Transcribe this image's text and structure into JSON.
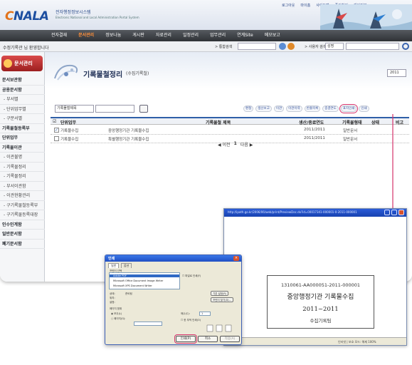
{
  "header": {
    "logo_lead": "C",
    "logo_rest": "NALA",
    "system_name": "전자행정정보시스템",
    "system_name_en": "Electronic National and Local Administration Portal System",
    "util_links": [
      "로그아웃",
      "마이홈",
      "사이트맵",
      "즐겨찾기",
      "개인정보"
    ]
  },
  "menu": [
    "전자결재",
    "문서관리",
    "정보나눔",
    "게시판",
    "자료관리",
    "일정관리",
    "업무관리",
    "연계Site",
    "메모보고"
  ],
  "menu_active_index": 1,
  "status": {
    "login": "수정기록관 님 환영합니다",
    "combined_search": "> 통합검색",
    "user_search": "> 사용자 검색",
    "user_search_option": "성명"
  },
  "sidebar": {
    "header": "문서관리",
    "items": [
      {
        "label": "문서보관함",
        "kind": "group"
      },
      {
        "label": "공용문서함",
        "kind": "group"
      },
      {
        "label": "- 부서별",
        "kind": "sub"
      },
      {
        "label": "- 단위업무별",
        "kind": "sub"
      },
      {
        "label": "- 구분서별",
        "kind": "sub"
      },
      {
        "label": "기록물철등록부",
        "kind": "group"
      },
      {
        "label": "단위업무",
        "kind": "group"
      },
      {
        "label": "기록물이관",
        "kind": "group"
      },
      {
        "label": "- 이관불명",
        "kind": "sub"
      },
      {
        "label": "- 기록물정리",
        "kind": "sub"
      },
      {
        "label": "- 기록물정리",
        "kind": "sub"
      },
      {
        "label": "- 부서이관함",
        "kind": "sub"
      },
      {
        "label": "- 이관현황관리",
        "kind": "sub"
      },
      {
        "label": "- 구기록물철등록부",
        "kind": "sub"
      },
      {
        "label": "- 구기록물등록대장",
        "kind": "sub"
      },
      {
        "label": "인수인계함",
        "kind": "group"
      },
      {
        "label": "일반문서함",
        "kind": "group"
      },
      {
        "label": "폐기문서함",
        "kind": "group"
      }
    ]
  },
  "page": {
    "title": "기록물철정리",
    "subtitle": "(수집기록철)",
    "year": "2011",
    "filter_option": "기록물철제목",
    "actions": [
      "편철",
      "생산보고",
      "이관",
      "이관이력",
      "반출목록",
      "종결연도",
      "표지인쇄",
      "인쇄"
    ],
    "highlighted_action_index": 6
  },
  "table": {
    "headers": {
      "task": "단위업무",
      "title": "기록물철 제목",
      "years": "생산/종료연도",
      "type": "기록물형태",
      "state": "상태",
      "note": "비고"
    },
    "rows": [
      {
        "task": "기록물수집",
        "title": "중앙행정기관 기록물수집",
        "years": "2011/2011",
        "type": "일반문서",
        "checked": true
      },
      {
        "task": "기록물수집",
        "title": "특별행정기관 기록물수집",
        "years": "2011/2011",
        "type": "일반문서",
        "checked": false
      }
    ]
  },
  "pagination": {
    "prev": "◀ 이전",
    "current": "1",
    "next": "다음 ▶"
  },
  "preview": {
    "url": "http://ipath.go.kr/2006/06/web/print/PreviewDoc.do?id=00017341-000001-0-2011-000001",
    "label_number": "1310061-AA000051-2011-000001",
    "label_title": "중앙행정기관 기록물수집",
    "label_years": "2011~2011",
    "label_author": "수집기록팀",
    "status": "인터넷 | 보호 모드: 해제        100%"
  },
  "print_dialog": {
    "title": "인쇄",
    "tabs": [
      "일반",
      "옵션"
    ],
    "select_printer_label": "프린터 선택",
    "printers": [
      "Adobe PDF",
      "Microsoft Office Document Image Writer",
      "Microsoft XPS Document Writer"
    ],
    "selected_printer_index": 0,
    "print_to_file": "파일로 인쇄(F)",
    "preferences": "기본 설정(R)",
    "find_printer": "프린터 찾기(D)...",
    "status_label": "상태:",
    "status_value": "준비됨",
    "location_label": "위치:",
    "comment_label": "설명:",
    "page_range_label": "페이지 범위",
    "all_pages": "모두(L)",
    "pages_label": "페이지(G):",
    "copies_label": "매수(C):",
    "copies_value": "1",
    "collate": "한 부씩 인쇄(O)",
    "print_button": "인쇄(P)",
    "cancel_button": "취소",
    "apply_button": "적용(A)"
  },
  "colors": {
    "accent": "#2f5fa8",
    "highlight": "#d6336c",
    "sidebar_header": "#c43535",
    "menu_active": "#ff8f3a"
  }
}
